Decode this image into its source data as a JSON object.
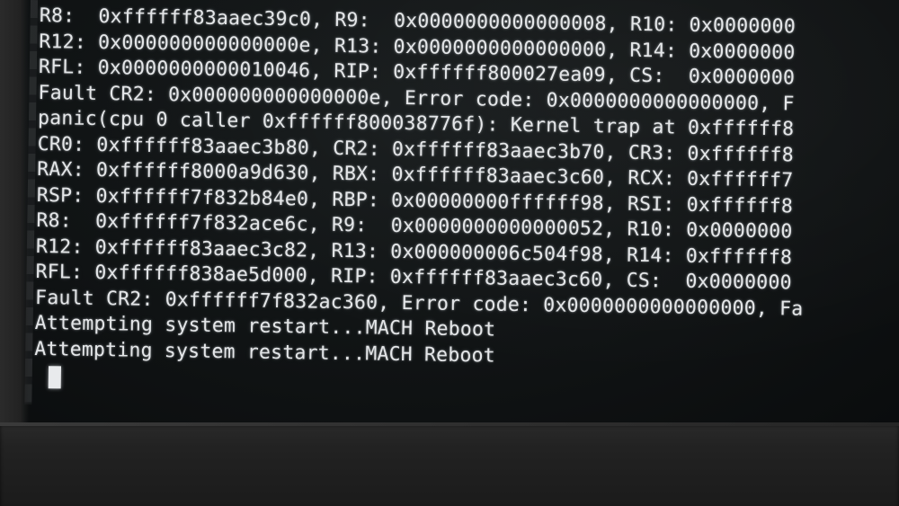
{
  "terminal": {
    "lines": [
      "R8:  0xffffff83aaec39c0, R9:  0x0000000000000008, R10: 0x0000000",
      "R12: 0x000000000000000e, R13: 0x0000000000000000, R14: 0x0000000",
      "RFL: 0x0000000000010046, RIP: 0xffffff800027ea09, CS:  0x0000000",
      "Fault CR2: 0x000000000000000e, Error code: 0x0000000000000000, F",
      "panic(cpu 0 caller 0xffffff800038776f): Kernel trap at 0xffffff8",
      "CR0: 0xffffff83aaec3b80, CR2: 0xffffff83aaec3b70, CR3: 0xffffff8",
      "RAX: 0xffffff8000a9d630, RBX: 0xffffff83aaec3c60, RCX: 0xffffff7",
      "RSP: 0xffffff7f832b84e0, RBP: 0x00000000ffffff98, RSI: 0xffffff8",
      "R8:  0xffffff7f832ace6c, R9:  0x0000000000000052, R10: 0x0000000",
      "R12: 0xffffff83aaec3c82, R13: 0x000000006c504f98, R14: 0xffffff8",
      "RFL: 0xffffff838ae5d000, RIP: 0xffffff83aaec3c60, CS:  0x0000000",
      "Fault CR2: 0xffffff7f832ac360, Error code: 0x0000000000000000, Fa",
      "Attempting system restart...MACH Reboot",
      "Attempting system restart...MACH Reboot"
    ]
  }
}
